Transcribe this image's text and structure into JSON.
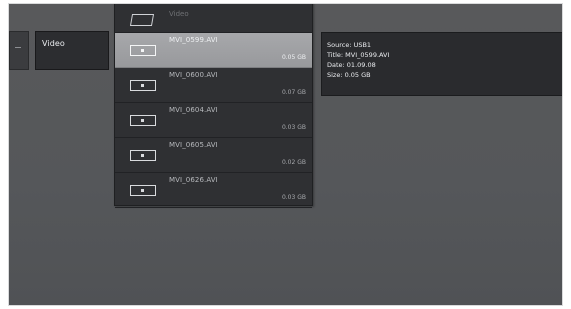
{
  "category": {
    "label": "Video"
  },
  "folder": {
    "name": "Video"
  },
  "files": [
    {
      "name": "MVI_0599.AVI",
      "size": "0.05 GB",
      "selected": true
    },
    {
      "name": "MVI_0600.AVI",
      "size": "0.07 GB",
      "selected": false
    },
    {
      "name": "MVI_0604.AVI",
      "size": "0.03 GB",
      "selected": false
    },
    {
      "name": "MVI_0605.AVI",
      "size": "0.02 GB",
      "selected": false
    },
    {
      "name": "MVI_0626.AVI",
      "size": "0.03 GB",
      "selected": false
    }
  ],
  "info": {
    "source": "Source: USB1",
    "title": "Title: MVI_0599.AVI",
    "date": "Date: 01.09.08",
    "size": "Size: 0.05 GB"
  },
  "icons": {
    "file": "video-file-icon",
    "folder": "folder-icon",
    "left_col": "minus-icon"
  },
  "colors": {
    "background": "#56585b",
    "panel": "#2f3033",
    "selected": "#a0a1a4",
    "text": "#eceef1"
  }
}
